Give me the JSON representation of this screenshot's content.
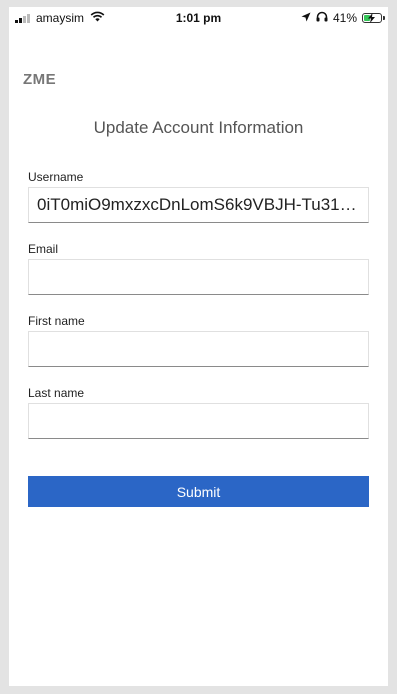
{
  "status_bar": {
    "carrier": "amaysim",
    "time": "1:01 pm",
    "battery": "41%",
    "battery_level": 0.41,
    "icons": [
      "signal-icon",
      "wifi-icon",
      "location-arrow-icon",
      "headphones-icon",
      "battery-charging-icon"
    ]
  },
  "brand": "ZME",
  "page_title": "Update Account Information",
  "form": {
    "username": {
      "label": "Username",
      "value": "0iT0miO9mxzxcDnLomS6k9VBJH-Tu315z..."
    },
    "email": {
      "label": "Email",
      "value": ""
    },
    "first_name": {
      "label": "First name",
      "value": ""
    },
    "last_name": {
      "label": "Last name",
      "value": ""
    },
    "submit_label": "Submit"
  },
  "colors": {
    "accent": "#2b66c6",
    "battery": "#35c759"
  }
}
